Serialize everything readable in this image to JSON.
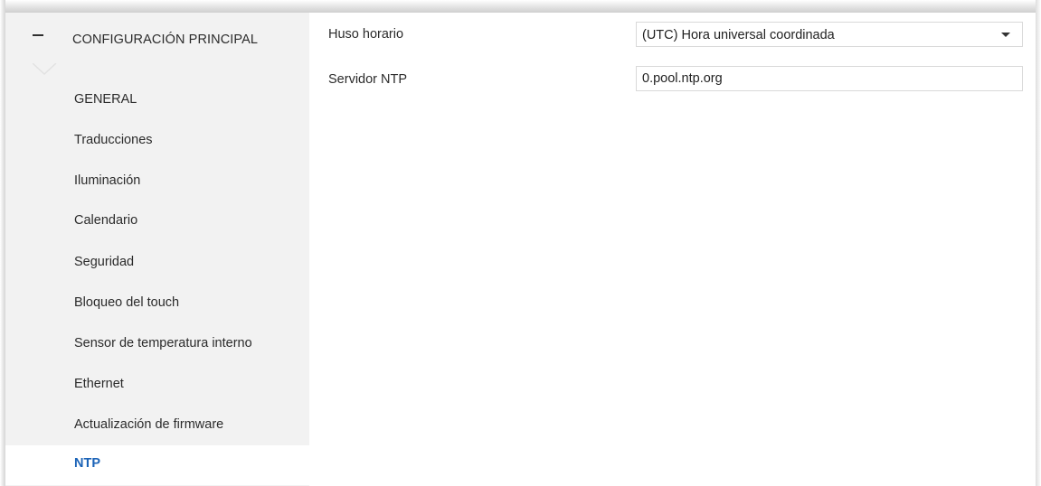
{
  "sidebar": {
    "header": {
      "label": "CONFIGURACIÓN PRINCIPAL",
      "collapse_icon": "minus-icon"
    },
    "items": [
      {
        "label": "GENERAL",
        "active": false
      },
      {
        "label": "Traducciones",
        "active": false
      },
      {
        "label": "Iluminación",
        "active": false
      },
      {
        "label": "Calendario",
        "active": false
      },
      {
        "label": "Seguridad",
        "active": false
      },
      {
        "label": "Bloqueo del touch",
        "active": false
      },
      {
        "label": "Sensor de temperatura interno",
        "active": false
      },
      {
        "label": "Ethernet",
        "active": false
      },
      {
        "label": "Actualización de firmware",
        "active": false
      },
      {
        "label": "NTP",
        "active": true
      }
    ]
  },
  "main": {
    "timezone": {
      "label": "Huso horario",
      "selected": "(UTC) Hora universal coordinada",
      "icon": "dropdown-arrow-icon"
    },
    "ntp_server": {
      "label": "Servidor NTP",
      "value": "0.pool.ntp.org"
    }
  },
  "colors": {
    "active_item_text": "#1b63b7",
    "sidebar_background": "#f2f2f2",
    "content_background": "#ffffff"
  }
}
